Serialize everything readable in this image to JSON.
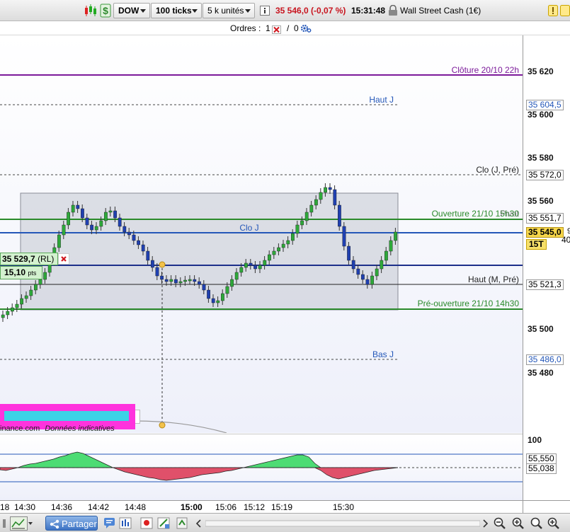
{
  "toolbar": {
    "instrument": "DOW",
    "timeframe": "100 ticks",
    "units": "5 k unités",
    "price_change": "35 546,0 (-0,07 %)",
    "time": "15:31:48",
    "instrument_name": "Wall Street Cash (1€)",
    "colors": {
      "negative": "#c8141e",
      "positive": "#1f8a2e"
    }
  },
  "orders": {
    "label": "Ordres :",
    "count_open": "1",
    "separator": "/",
    "count_pending": "0"
  },
  "chart": {
    "lines": {
      "cloture_label": "Clôture 20/10 22h",
      "haut_j_label": "Haut J",
      "clo_j_pre_label": "Clo (J, Pré)",
      "ouverture_label": "Ouverture 21/10 15h30",
      "pivot_label": "Pivot",
      "clo_j_label": "Clo J",
      "haut_m_pre_label": "Haut (M, Pré)",
      "preouverture_label": "Pré-ouverture 21/10 14h30",
      "bas_j_label": "Bas J"
    },
    "order_tag": {
      "price": "35 529,7",
      "suffix": "(RL)",
      "pts": "15,10",
      "pts_unit": "pts"
    },
    "source_text": "inance.com",
    "source_note": "Données indicatives",
    "price_axis": {
      "ticks": [
        "35 620",
        "35 600",
        "35 580",
        "35 560",
        "35 500",
        "35 480"
      ],
      "boxes": {
        "haut_j": "35 604,5",
        "clo_j_pre": "35 572,0",
        "ouverture": "35 551,7",
        "current": "35 545,0",
        "current_partial_right": "9",
        "partial_under": "40",
        "timer": "15T",
        "haut_m": "35 521,3",
        "bas_j": "35 486,0"
      },
      "indicator_top": "100",
      "indicator_box1": "55,550",
      "indicator_box2": "55,038"
    },
    "time_axis": {
      "labels": [
        "18",
        "14:30",
        "14:36",
        "14:42",
        "14:48",
        "15:00",
        "15:06",
        "15:12",
        "15:19",
        "15:30"
      ]
    }
  },
  "bottom": {
    "share_label": "Partager"
  }
}
